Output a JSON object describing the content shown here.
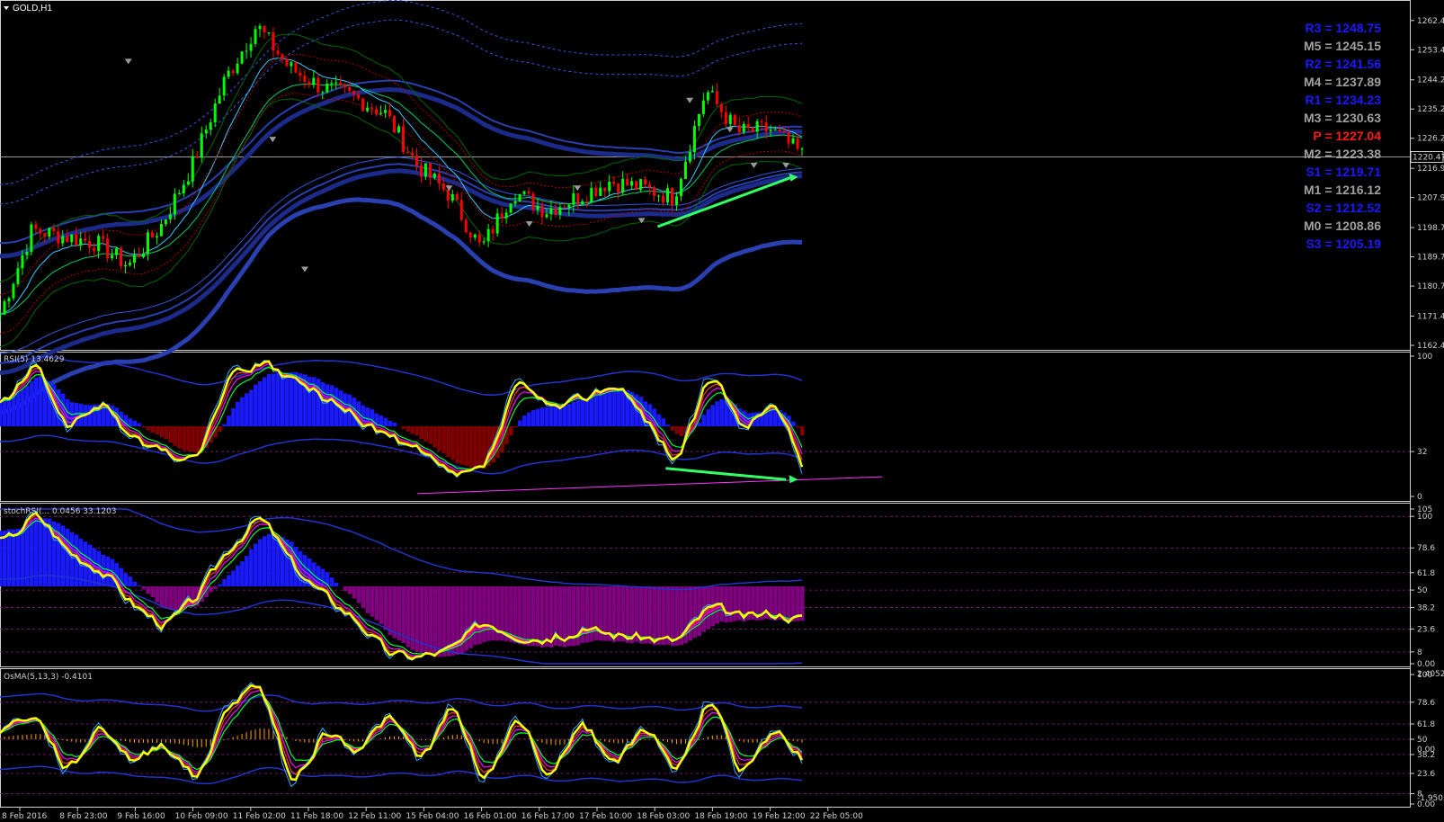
{
  "window": {
    "symbol_label": "GOLD,H1"
  },
  "chart_data": [
    {
      "type": "line",
      "name": "price",
      "ylim": [
        1162.45,
        1266.0
      ],
      "y_ticks": [
        "1262.45",
        "1253.45",
        "1244.20",
        "1235.20",
        "1226.20",
        "1216.95",
        "1207.95",
        "1198.70",
        "1189.70",
        "1180.70",
        "1171.45",
        "1162.45"
      ],
      "current_price": "1220.47",
      "current_value": 1220.47,
      "x": [
        0,
        4,
        8,
        12,
        16,
        20,
        24,
        28,
        32,
        36,
        40,
        44,
        48,
        52,
        56,
        60,
        64,
        68,
        72,
        76,
        80,
        84,
        88,
        92,
        96,
        100
      ],
      "close": [
        1172,
        1198,
        1196,
        1194,
        1187,
        1199,
        1218,
        1244,
        1261,
        1248,
        1242,
        1239,
        1234,
        1218,
        1209,
        1192,
        1210,
        1204,
        1208,
        1213,
        1211,
        1208,
        1241,
        1228,
        1229,
        1221
      ],
      "pivots": [
        {
          "label": "R3 = 1248.75",
          "color": "#1a1aff"
        },
        {
          "label": "M5 = 1245.15",
          "color": "#a0a0a0"
        },
        {
          "label": "R2 = 1241.56",
          "color": "#1a1aff"
        },
        {
          "label": "M4 = 1237.89",
          "color": "#a0a0a0"
        },
        {
          "label": "R1 = 1234.23",
          "color": "#1a1aff"
        },
        {
          "label": "M3 = 1230.63",
          "color": "#a0a0a0"
        },
        {
          "label": "P   = 1227.04",
          "color": "#ff1a1a"
        },
        {
          "label": "M2 = 1223.38",
          "color": "#a0a0a0"
        },
        {
          "label": "S1 = 1219.71",
          "color": "#1a1aff"
        },
        {
          "label": "M1 = 1216.12",
          "color": "#a0a0a0"
        },
        {
          "label": "S2 = 1212.52",
          "color": "#1a1aff"
        },
        {
          "label": "M0 = 1208.86",
          "color": "#a0a0a0"
        },
        {
          "label": "S3 = 1205.19",
          "color": "#1a1aff"
        }
      ]
    },
    {
      "type": "line",
      "name": "rsi",
      "label": "RSI(5) 13.4629",
      "ylim": [
        0,
        100
      ],
      "y_ticks": [
        "100",
        "32",
        "0"
      ],
      "x": [
        0,
        4,
        8,
        12,
        16,
        20,
        24,
        28,
        32,
        36,
        40,
        44,
        48,
        52,
        56,
        60,
        64,
        68,
        72,
        76,
        80,
        84,
        88,
        92,
        96,
        100
      ],
      "values": [
        65,
        96,
        45,
        70,
        40,
        30,
        25,
        88,
        95,
        82,
        70,
        55,
        42,
        30,
        12,
        20,
        85,
        60,
        70,
        82,
        55,
        22,
        92,
        45,
        70,
        13
      ]
    },
    {
      "type": "line",
      "name": "stochrsi",
      "label": "stochRSI(... 0.0456 33.1203",
      "ylim": [
        0,
        105
      ],
      "y_ticks": [
        "105",
        "100",
        "78.6",
        "61.8",
        "50",
        "38.2",
        "23.6",
        "8",
        "0.00"
      ],
      "x": [
        0,
        4,
        8,
        12,
        16,
        20,
        24,
        28,
        32,
        36,
        40,
        44,
        48,
        52,
        56,
        60,
        64,
        68,
        72,
        76,
        80,
        84,
        88,
        92,
        96,
        100
      ],
      "values": [
        80,
        104,
        75,
        65,
        40,
        25,
        45,
        80,
        102,
        65,
        45,
        30,
        5,
        5,
        10,
        30,
        20,
        18,
        22,
        20,
        18,
        15,
        40,
        30,
        35,
        30
      ]
    },
    {
      "type": "line",
      "name": "osma",
      "label": "OsMA(5,13,3) -0.4101",
      "ylim": [
        0,
        100
      ],
      "y_ticks": [
        "100",
        "78.6",
        "61.8",
        "50",
        "38.2",
        "23.6",
        "8",
        "0.00"
      ],
      "right_top": "2.4052",
      "right_mid": "0.00",
      "right_low": "-1.9503",
      "x": [
        0,
        4,
        8,
        12,
        16,
        20,
        24,
        28,
        32,
        36,
        40,
        44,
        48,
        52,
        56,
        60,
        64,
        68,
        72,
        76,
        80,
        84,
        88,
        92,
        96,
        100
      ],
      "values": [
        60,
        70,
        20,
        65,
        30,
        50,
        15,
        80,
        95,
        10,
        60,
        40,
        70,
        30,
        80,
        10,
        75,
        15,
        70,
        25,
        65,
        20,
        90,
        15,
        60,
        30
      ]
    }
  ],
  "time_axis": [
    "8 Feb 2016",
    "8 Feb 23:00",
    "9 Feb 16:00",
    "10 Feb 09:00",
    "11 Feb 02:00",
    "11 Feb 18:00",
    "12 Feb 11:00",
    "15 Feb 04:00",
    "16 Feb 01:00",
    "16 Feb 17:00",
    "17 Feb 10:00",
    "18 Feb 03:00",
    "18 Feb 19:00",
    "19 Feb 12:00",
    "22 Feb 05:00"
  ],
  "colors": {
    "up_candle": "#00ff00",
    "down_candle": "#ff0000",
    "hist_up": "#1a1aff",
    "hist_down_rsi": "#800000",
    "hist_down_stoch": "#800080",
    "signal": "#ffff00",
    "arrow": "#33ff66"
  }
}
